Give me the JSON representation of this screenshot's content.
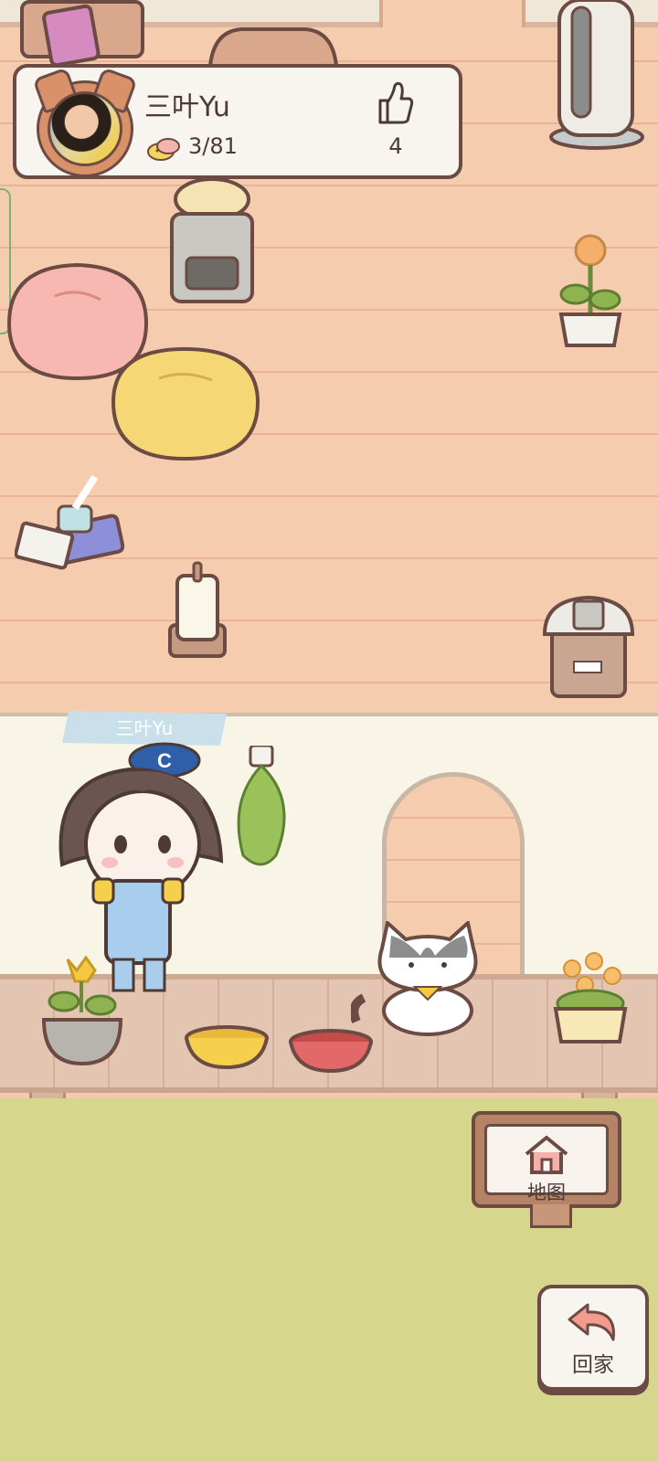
{
  "profile": {
    "name": "三叶Yu",
    "fish_count": "3/81",
    "likes": "4"
  },
  "scene": {
    "character_name_tag": "三叶Yu"
  },
  "buttons": {
    "map_label": "地图",
    "home_label": "回家"
  },
  "icons": {
    "like": "thumbs-up-icon",
    "fish": "fish-icon",
    "map": "house-icon",
    "home": "return-arrow-icon"
  },
  "colors": {
    "outline": "#6b4b43",
    "floor": "#f6ccaf",
    "grass": "#d6d78d",
    "card_bg": "#f8f4ef"
  }
}
